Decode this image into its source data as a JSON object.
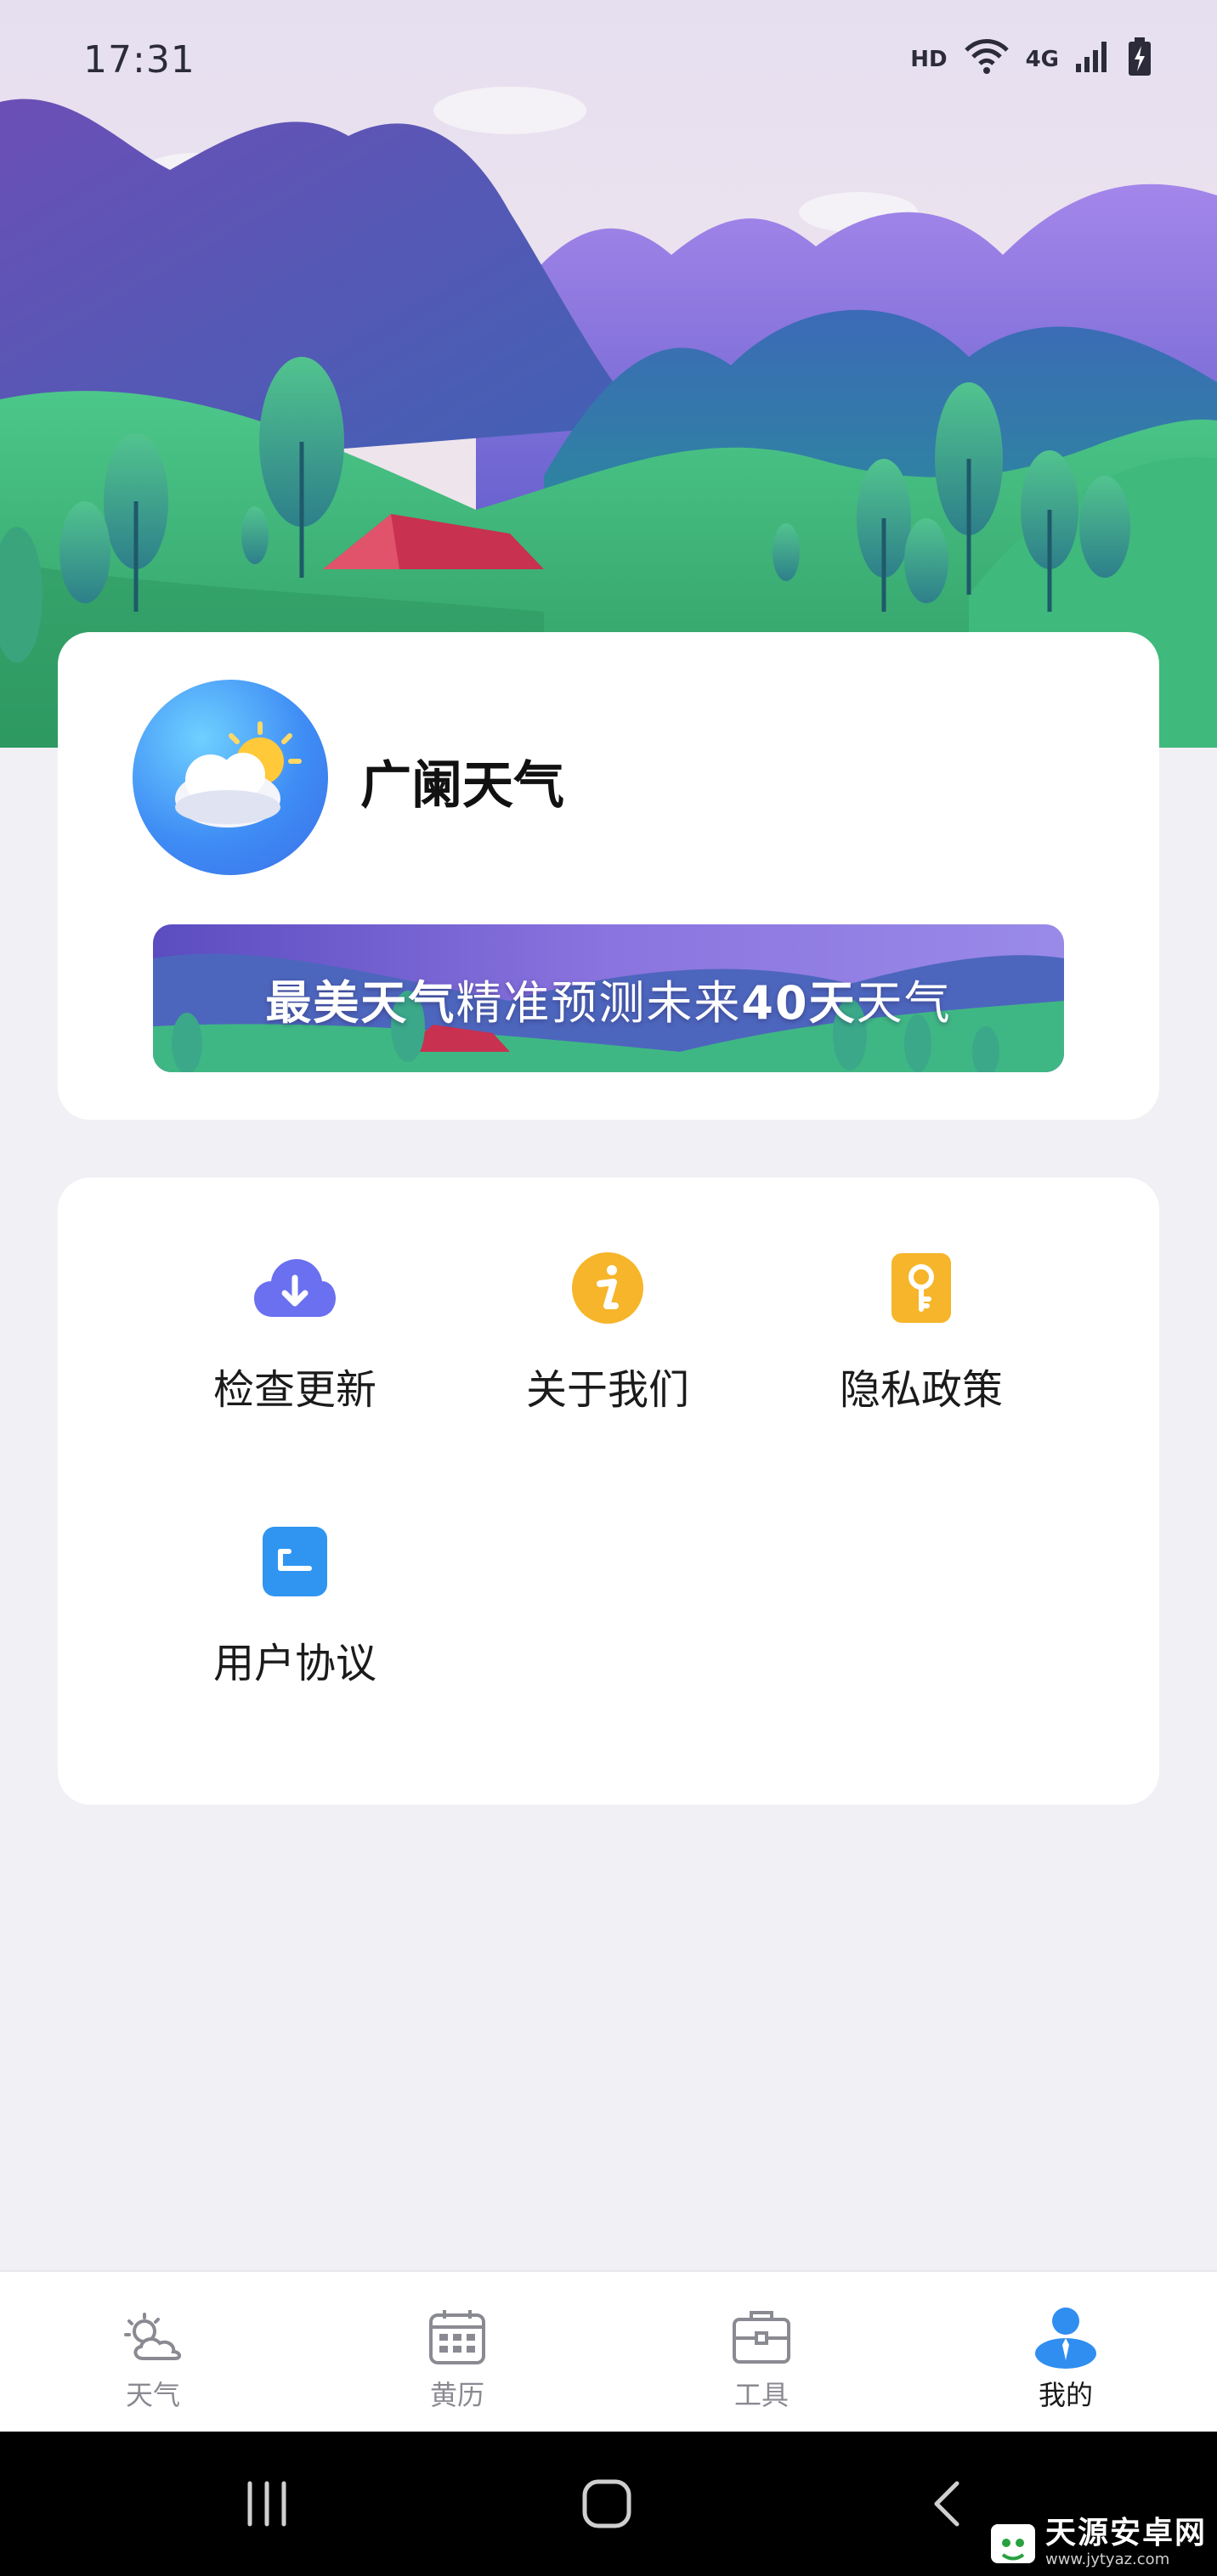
{
  "status_bar": {
    "time": "17:31",
    "hd": "HD",
    "network": "4G",
    "icons": [
      "wifi-icon",
      "signal-icon",
      "battery-charging-icon"
    ]
  },
  "app": {
    "name": "广阑天气",
    "logo_icon": "cloud-sun-icon"
  },
  "banner": {
    "part1": "最美天气",
    "part2": "精准预测未来",
    "part3": "40天",
    "part4": "天气"
  },
  "menu": {
    "items": [
      {
        "label": "检查更新",
        "icon": "cloud-download-icon",
        "color": "#6a70f0"
      },
      {
        "label": "关于我们",
        "icon": "info-icon",
        "color": "#f6b52a"
      },
      {
        "label": "隐私政策",
        "icon": "key-icon",
        "color": "#f6b52a"
      },
      {
        "label": "用户协议",
        "icon": "document-icon",
        "color": "#2f95f0"
      }
    ]
  },
  "bottom_nav": {
    "items": [
      {
        "label": "天气",
        "icon": "weather-icon",
        "active": false
      },
      {
        "label": "黄历",
        "icon": "calendar-icon",
        "active": false
      },
      {
        "label": "工具",
        "icon": "toolbox-icon",
        "active": false
      },
      {
        "label": "我的",
        "icon": "user-icon",
        "active": true
      }
    ],
    "active_color": "#2f8ef0",
    "inactive_color": "#8a8a92"
  },
  "watermark": {
    "title": "天源安卓网",
    "url": "www.jytyaz.com"
  }
}
